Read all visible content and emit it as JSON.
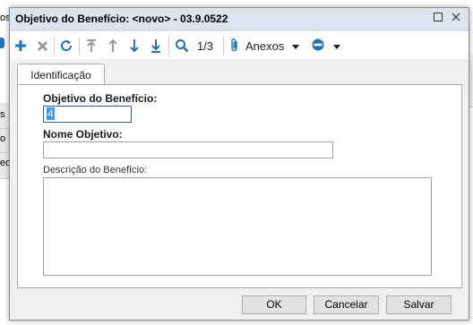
{
  "background": {
    "fragments": [
      "os",
      "s",
      "o",
      "ed"
    ]
  },
  "dialog": {
    "title": "Objetivo do Benefício: <novo> - 03.9.0522",
    "window_buttons": {
      "maximize_icon": "maximize-icon",
      "close_icon": "close-icon"
    }
  },
  "toolbar": {
    "record_position": "1/3",
    "attachments_label": "Anexos",
    "icons": [
      "add-icon",
      "delete-icon",
      "refresh-icon",
      "first-record-icon",
      "previous-record-icon",
      "next-record-icon",
      "last-record-icon",
      "search-icon",
      "paperclip-icon",
      "more-options-icon"
    ],
    "colors": {
      "accent": "#1e73be"
    }
  },
  "tabs": [
    {
      "label": "Identificação",
      "active": true
    }
  ],
  "form": {
    "objetivo_label": "Objetivo do Benefício:",
    "objetivo_value": "4",
    "nome_label": "Nome Objetivo:",
    "nome_value": "",
    "descricao_label": "Descrição do Benefício:",
    "descricao_value": ""
  },
  "buttons": {
    "ok": "OK",
    "cancel": "Cancelar",
    "save": "Salvar"
  }
}
